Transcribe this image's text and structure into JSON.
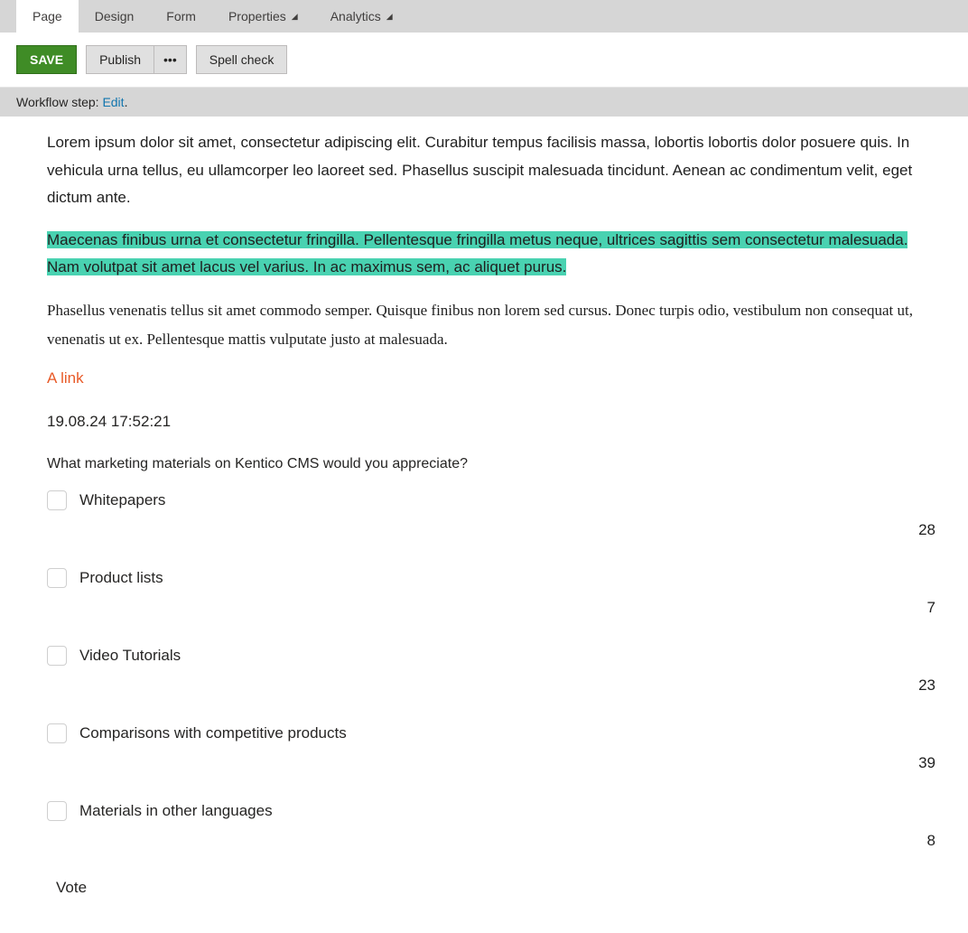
{
  "tabs": [
    {
      "label": "Page",
      "active": true,
      "hasCaret": false
    },
    {
      "label": "Design",
      "active": false,
      "hasCaret": false
    },
    {
      "label": "Form",
      "active": false,
      "hasCaret": false
    },
    {
      "label": "Properties",
      "active": false,
      "hasCaret": true
    },
    {
      "label": "Analytics",
      "active": false,
      "hasCaret": true
    }
  ],
  "toolbar": {
    "save": "SAVE",
    "publish": "Publish",
    "more": "•••",
    "spellcheck": "Spell check"
  },
  "workflow": {
    "prefix": "Workflow step: ",
    "step": "Edit",
    "suffix": "."
  },
  "content": {
    "p1": "Lorem ipsum dolor sit amet, consectetur adipiscing elit. Curabitur tempus facilisis massa, lobortis lobortis dolor posuere quis. In vehicula urna tellus, eu ullamcorper leo laoreet sed. Phasellus suscipit malesuada tincidunt. Aenean ac condimentum velit, eget dictum ante.",
    "p2_highlighted": "Maecenas finibus urna et consectetur fringilla. Pellentesque fringilla metus neque, ultrices sagittis sem consectetur malesuada. Nam volutpat sit amet lacus vel varius. In ac maximus sem, ac aliquet purus.",
    "p3": "Phasellus venenatis tellus sit amet commodo semper. Quisque finibus non lorem sed cursus. Donec turpis odio, vestibulum non consequat ut, venenatis ut ex. Pellentesque mattis vulputate justo at malesuada.",
    "link": "A link",
    "timestamp": "19.08.24 17:52:21"
  },
  "poll": {
    "question": "What marketing materials on Kentico CMS would you appreciate?",
    "options": [
      {
        "label": "Whitepapers",
        "count": "28"
      },
      {
        "label": "Product lists",
        "count": "7"
      },
      {
        "label": "Video Tutorials",
        "count": "23"
      },
      {
        "label": "Comparisons with competitive products",
        "count": "39"
      },
      {
        "label": "Materials in other languages",
        "count": "8"
      }
    ],
    "vote": "Vote"
  }
}
